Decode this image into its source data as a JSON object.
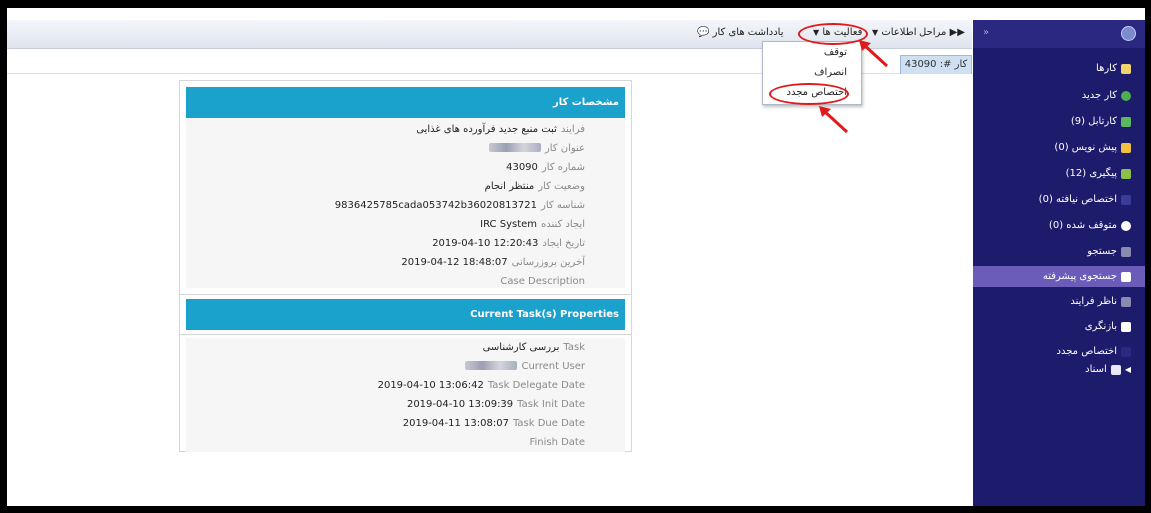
{
  "toolbar": {
    "stages": "مراحل",
    "info": "اطلاعات",
    "activities": "فعالیت ها",
    "notes": "یادداشت های کار"
  },
  "case_tab": "کار #: 43090",
  "dropdown": {
    "items": [
      "توقف",
      "انصراف",
      "اختصاص مجدد"
    ]
  },
  "sidebar": {
    "cases_header": "کارها",
    "items": [
      {
        "label": "کار جدید",
        "icon": "plus-icon",
        "color": "#4caf50"
      },
      {
        "label": "کارتابل (9)",
        "icon": "inbox-icon",
        "color": "#5cb85c"
      },
      {
        "label": "پیش نویس (0)",
        "icon": "pencil-icon",
        "color": "#f0c040"
      },
      {
        "label": "پیگیری (12)",
        "icon": "document-icon",
        "color": "#8bc34a"
      },
      {
        "label": "اختصاص نیافته (0)",
        "icon": "unassigned-icon",
        "color": "#3a3a9a"
      },
      {
        "label": "متوقف شده (0)",
        "icon": "pause-icon",
        "color": "#ffffff"
      }
    ],
    "search_header": "جستجو",
    "advanced_search": "جستجوی پیشرفته",
    "process_supervisor": "ناظر فرایند",
    "review": "بازنگری",
    "reassign": "اختصاص مجدد",
    "documents": "اسناد"
  },
  "case_props": {
    "title": "مشخصات کار",
    "rows": [
      {
        "label": "فرایند",
        "value": "ثبت منبع جدید فرآورده های غذایی"
      },
      {
        "label": "عنوان کار",
        "value": ""
      },
      {
        "label": "شماره کار",
        "value": "43090"
      },
      {
        "label": "وضعیت کار",
        "value": "منتظر انجام"
      },
      {
        "label": "شناسه کار",
        "value": "9836425785cada053742b36020813721"
      },
      {
        "label": "ایجاد کننده",
        "value": "IRC System"
      },
      {
        "label": "تاریخ ایجاد",
        "value": "2019-04-10 12:20:43"
      },
      {
        "label": "آخرین بروزرسانی",
        "value": "2019-04-12 18:48:07"
      },
      {
        "label": "Case Description",
        "value": ""
      }
    ]
  },
  "task_props": {
    "title": "Current Task(s) Properties",
    "rows": [
      {
        "label": "Task",
        "value": "بررسی کارشناسی"
      },
      {
        "label": "Current User",
        "value": ""
      },
      {
        "label": "Task Delegate Date",
        "value": "2019-04-10 13:06:42"
      },
      {
        "label": "Task Init Date",
        "value": "2019-04-10 13:09:39"
      },
      {
        "label": "Task Due Date",
        "value": "2019-04-11 13:08:07"
      },
      {
        "label": "Finish Date",
        "value": ""
      }
    ]
  },
  "colors": {
    "sidebar_bg": "#1d1b6b",
    "header_blue": "#1aa1cc",
    "highlight": "#6a5cb8",
    "annotation_red": "#e01a1a"
  }
}
